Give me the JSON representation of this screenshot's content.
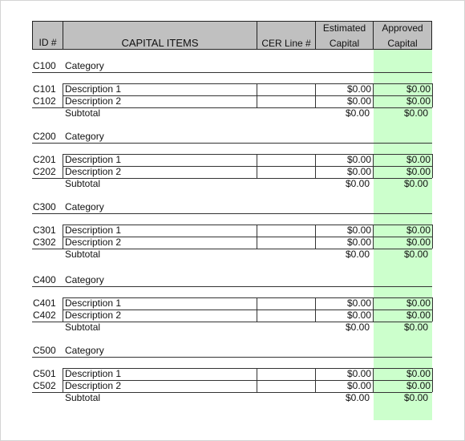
{
  "header": {
    "id": "ID #",
    "items": "CAPITAL ITEMS",
    "cer": "CER Line #",
    "estimated_line1": "Estimated",
    "estimated_line2": "Capital",
    "approved_line1": "Approved",
    "approved_line2": "Capital"
  },
  "colors": {
    "header_bg": "#c0c0c0",
    "approved_column": "#ccffcc"
  },
  "sections": [
    {
      "id": "C100",
      "label": "Category",
      "rows": [
        {
          "id": "C101",
          "description": "Description 1",
          "cer": "",
          "estimated": "$0.00",
          "approved": "$0.00"
        },
        {
          "id": "C102",
          "description": "Description 2",
          "cer": "",
          "estimated": "$0.00",
          "approved": "$0.00"
        }
      ],
      "subtotal_label": "Subtotal",
      "subtotal_estimated": "$0.00",
      "subtotal_approved": "$0.00"
    },
    {
      "id": "C200",
      "label": "Category",
      "rows": [
        {
          "id": "C201",
          "description": "Description 1",
          "cer": "",
          "estimated": "$0.00",
          "approved": "$0.00"
        },
        {
          "id": "C202",
          "description": "Description 2",
          "cer": "",
          "estimated": "$0.00",
          "approved": "$0.00"
        }
      ],
      "subtotal_label": "Subtotal",
      "subtotal_estimated": "$0.00",
      "subtotal_approved": "$0.00"
    },
    {
      "id": "C300",
      "label": "Category",
      "rows": [
        {
          "id": "C301",
          "description": "Description 1",
          "cer": "",
          "estimated": "$0.00",
          "approved": "$0.00"
        },
        {
          "id": "C302",
          "description": "Description 2",
          "cer": "",
          "estimated": "$0.00",
          "approved": "$0.00"
        }
      ],
      "subtotal_label": "Subtotal",
      "subtotal_estimated": "$0.00",
      "subtotal_approved": "$0.00"
    },
    {
      "id": "C400",
      "label": "Category",
      "rows": [
        {
          "id": "C401",
          "description": "Description 1",
          "cer": "",
          "estimated": "$0.00",
          "approved": "$0.00"
        },
        {
          "id": "C402",
          "description": "Description 2",
          "cer": "",
          "estimated": "$0.00",
          "approved": "$0.00"
        }
      ],
      "subtotal_label": "Subtotal",
      "subtotal_estimated": "$0.00",
      "subtotal_approved": "$0.00"
    },
    {
      "id": "C500",
      "label": "Category",
      "rows": [
        {
          "id": "C501",
          "description": "Description 1",
          "cer": "",
          "estimated": "$0.00",
          "approved": "$0.00"
        },
        {
          "id": "C502",
          "description": "Description 2",
          "cer": "",
          "estimated": "$0.00",
          "approved": "$0.00"
        }
      ],
      "subtotal_label": "Subtotal",
      "subtotal_estimated": "$0.00",
      "subtotal_approved": "$0.00"
    }
  ]
}
